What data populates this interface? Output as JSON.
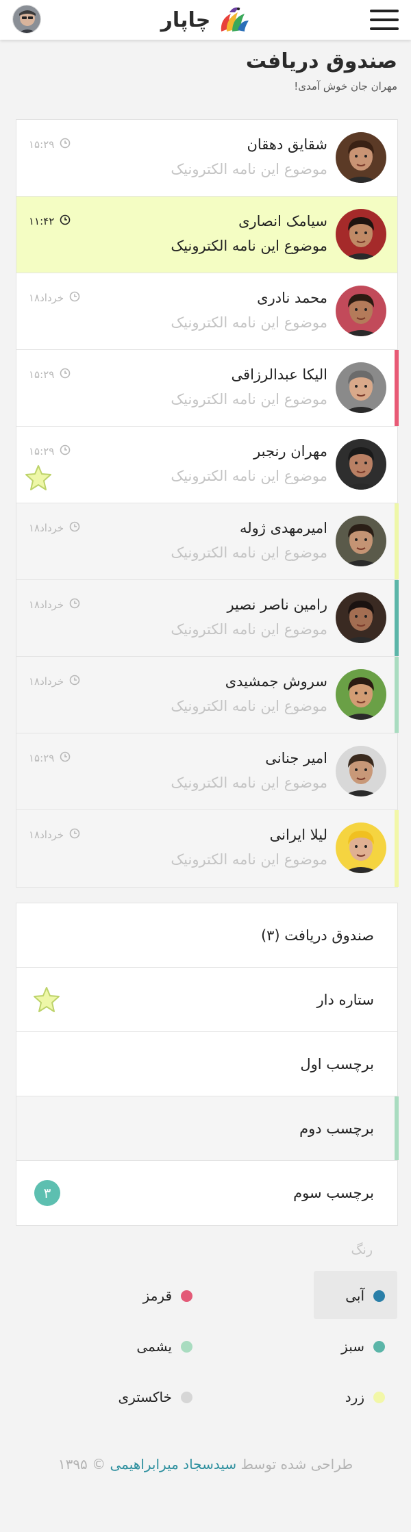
{
  "header": {
    "brand": "چاپار",
    "menu": "menu-icon",
    "logo": "bird-logo"
  },
  "page": {
    "title": "صندوق دریافت",
    "welcome": "مهران جان خوش آمدی!"
  },
  "messages": [
    {
      "name": "شقایق دهقان",
      "subject": "موضوع این نامه الکترونیک",
      "time": "۱۵:۲۹",
      "state": "unread",
      "accent": "",
      "starred": false,
      "skin": "#c99474",
      "hair": "#3a2114",
      "bg": "#5b3a26"
    },
    {
      "name": "سیامک انصاری",
      "subject": "موضوع این نامه الکترونیک",
      "time": "۱۱:۴۲",
      "state": "highlighted",
      "accent": "",
      "starred": false,
      "skin": "#c08a66",
      "hair": "#1e1410",
      "bg": "#a52a2a"
    },
    {
      "name": "محمد نادری",
      "subject": "موضوع این نامه الکترونیک",
      "time": "۱۸خرداد",
      "state": "unread",
      "accent": "",
      "starred": false,
      "skin": "#b47b5a",
      "hair": "#2b1b12",
      "bg": "#c24a5a"
    },
    {
      "name": "الیکا عبدالرزاقی",
      "subject": "موضوع این نامه الکترونیک",
      "time": "۱۵:۲۹",
      "state": "unread",
      "accent": "#e85a76",
      "starred": false,
      "skin": "#d9a98a",
      "hair": "#6b6b6b",
      "bg": "#8a8a8a"
    },
    {
      "name": "مهران رنجبر",
      "subject": "موضوع این نامه الکترونیک",
      "time": "۱۵:۲۹",
      "state": "unread",
      "accent": "",
      "starred": true,
      "skin": "#b98064",
      "hair": "#1a1a1a",
      "bg": "#2e2e2e"
    },
    {
      "name": "امیرمهدی ژوله",
      "subject": "موضوع این نامه الکترونیک",
      "time": "۱۸خرداد",
      "state": "read",
      "accent": "#eef7a8",
      "starred": false,
      "skin": "#c49474",
      "hair": "#2a1e16",
      "bg": "#5a5a4a"
    },
    {
      "name": "رامین ناصر نصیر",
      "subject": "موضوع این نامه الکترونیک",
      "time": "۱۸خرداد",
      "state": "read",
      "accent": "#5bb5a8",
      "starred": false,
      "skin": "#a36e52",
      "hair": "#1a1210",
      "bg": "#3a2a22"
    },
    {
      "name": "سروش جمشیدی",
      "subject": "موضوع این نامه الکترونیک",
      "time": "۱۸خرداد",
      "state": "read",
      "accent": "#a9dcc0",
      "starred": false,
      "skin": "#d29c74",
      "hair": "#2a1a12",
      "bg": "#6aa046"
    },
    {
      "name": "امیر جنانی",
      "subject": "موضوع این نامه الکترونیک",
      "time": "۱۵:۲۹",
      "state": "read",
      "accent": "",
      "starred": false,
      "skin": "#c89878",
      "hair": "#3a2a1e",
      "bg": "#d8d8d8"
    },
    {
      "name": "لیلا ایرانی",
      "subject": "موضوع این نامه الکترونیک",
      "time": "۱۸خرداد",
      "state": "read",
      "accent": "#f2f7a8",
      "starred": false,
      "skin": "#e0b092",
      "hair": "#f0c020",
      "bg": "#f5d440"
    }
  ],
  "folders": [
    {
      "label": "صندوق دریافت (۳)",
      "icon": "",
      "badge": "",
      "selected": false,
      "accent": ""
    },
    {
      "label": "ستاره دار",
      "icon": "star-icon",
      "badge": "",
      "selected": false,
      "accent": ""
    },
    {
      "label": "برچسب اول",
      "icon": "",
      "badge": "",
      "selected": false,
      "accent": ""
    },
    {
      "label": "برچسب دوم",
      "icon": "",
      "badge": "",
      "selected": true,
      "accent": "#a9dcc0"
    },
    {
      "label": "برچسب سوم",
      "icon": "",
      "badge": "۳",
      "selected": false,
      "accent": ""
    }
  ],
  "colors": {
    "title": "رنگ",
    "items": [
      {
        "label": "آبی",
        "color": "#2a7fa8",
        "active": true
      },
      {
        "label": "قرمز",
        "color": "#e35a77",
        "active": false
      },
      {
        "label": "سبز",
        "color": "#5bb5a8",
        "active": false
      },
      {
        "label": "یشمی",
        "color": "#a9dcc0",
        "active": false
      },
      {
        "label": "زرد",
        "color": "#f2f7a8",
        "active": false
      },
      {
        "label": "خاکستری",
        "color": "#d6d6d6",
        "active": false
      }
    ]
  },
  "footer": {
    "prefix": "طراحی شده توسط",
    "author": "سیدسجاد میرابراهیمی",
    "suffix": "© ۱۳۹۵"
  }
}
